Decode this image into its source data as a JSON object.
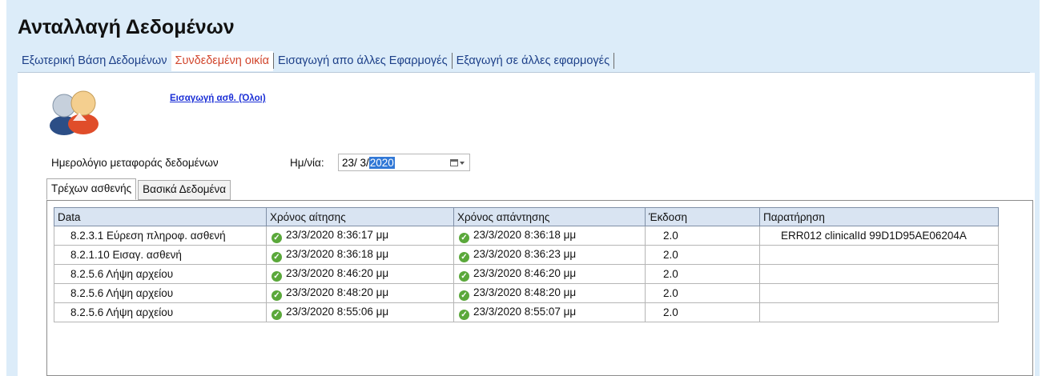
{
  "page": {
    "title": "Ανταλλαγή Δεδομένων"
  },
  "tabs": [
    {
      "label": "Εξωτερική Βάση Δεδομένων"
    },
    {
      "label": "Συνδεδεμένη οικία"
    },
    {
      "label": "Εισαγωγή απο άλλες Εφαρμογές"
    },
    {
      "label": "Εξαγωγή σε άλλες εφαρμογές"
    }
  ],
  "import_link": "Εισαγωγή ασθ. (Όλοι)",
  "log": {
    "label": "Ημερολόγιο μεταφοράς δεδομένων",
    "date_label": "Ημ/νία:",
    "date_day_month": "23/  3/",
    "date_year": "2020"
  },
  "subtabs": [
    {
      "label": "Τρέχων ασθενής"
    },
    {
      "label": "Βασικά Δεδομένα"
    }
  ],
  "table": {
    "headers": [
      "Data",
      "Χρόνος αίτησης",
      "Χρόνος απάντησης",
      "Έκδοση",
      "Παρατήρηση"
    ],
    "rows": [
      [
        "8.2.3.1 Εύρεση πληροφ. ασθενή",
        "23/3/2020 8:36:17 μμ",
        "23/3/2020 8:36:18 μμ",
        "2.0",
        "ERR012 clinicalId 99D1D95AE06204A"
      ],
      [
        "8.2.1.10 Εισαγ. ασθενή",
        "23/3/2020 8:36:18 μμ",
        "23/3/2020 8:36:23 μμ",
        "2.0",
        ""
      ],
      [
        "8.2.5.6 Λήψη αρχείου",
        "23/3/2020 8:46:20 μμ",
        "23/3/2020 8:46:20 μμ",
        "2.0",
        ""
      ],
      [
        "8.2.5.6 Λήψη αρχείου",
        "23/3/2020 8:48:20 μμ",
        "23/3/2020 8:48:20 μμ",
        "2.0",
        ""
      ],
      [
        "8.2.5.6 Λήψη αρχείου",
        "23/3/2020 8:55:06 μμ",
        "23/3/2020 8:55:07 μμ",
        "2.0",
        ""
      ]
    ]
  },
  "icons": {
    "avatar": "users-icon",
    "status": "check-circle-icon",
    "calendar": "calendar-dropdown-icon"
  },
  "colors": {
    "panel_bg": "#dcecf9",
    "tab_text": "#1c3f88",
    "active_tab": "#d1462d",
    "link": "#1b2fd6",
    "ok": "#5aa83a"
  }
}
